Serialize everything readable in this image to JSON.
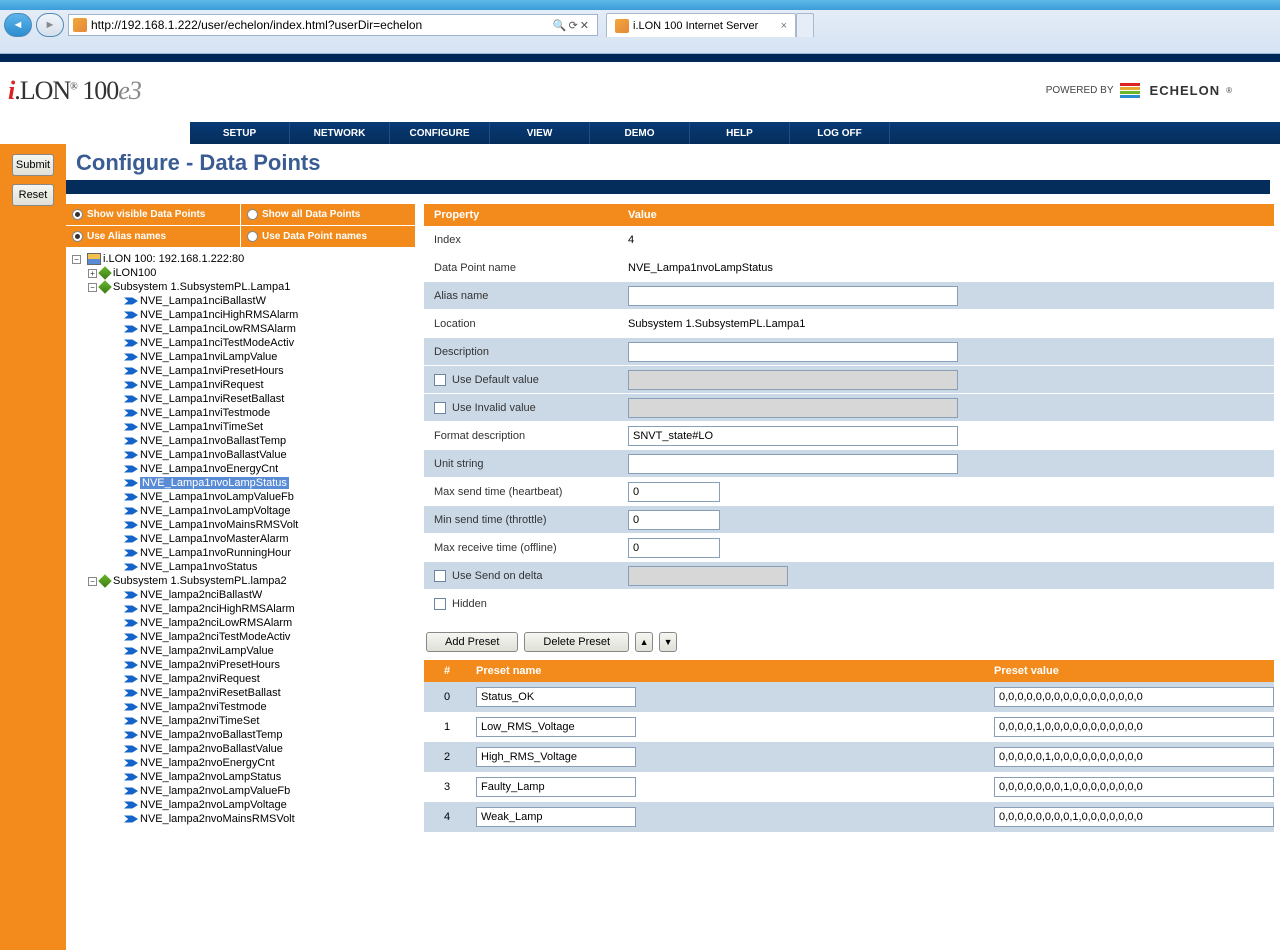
{
  "browser": {
    "url": "http://192.168.1.222/user/echelon/index.html?userDir=echelon",
    "tab_title": "i.LON 100 Internet Server",
    "search_symbol": "🔍",
    "refresh_symbol": "⟳",
    "stop_symbol": "✕"
  },
  "brand": {
    "logo_html": "i.LON 100e3",
    "powered_by": "POWERED BY",
    "vendor": "ECHELON"
  },
  "menu": [
    "SETUP",
    "NETWORK",
    "CONFIGURE",
    "VIEW",
    "DEMO",
    "HELP",
    "LOG OFF"
  ],
  "left_buttons": {
    "submit": "Submit",
    "reset": "Reset"
  },
  "page_title": "Configure - Data Points",
  "toggles": {
    "show_visible": "Show visible Data Points",
    "show_all": "Show all Data Points",
    "use_alias": "Use Alias names",
    "use_dp": "Use Data Point names"
  },
  "tree": {
    "root": "i.LON 100: 192.168.1.222:80",
    "device": "iLON100",
    "subsys1": "Subsystem 1.SubsystemPL.Lampa1",
    "subsys1_items": [
      "NVE_Lampa1nciBallastW",
      "NVE_Lampa1nciHighRMSAlarm",
      "NVE_Lampa1nciLowRMSAlarm",
      "NVE_Lampa1nciTestModeActiv",
      "NVE_Lampa1nviLampValue",
      "NVE_Lampa1nviPresetHours",
      "NVE_Lampa1nviRequest",
      "NVE_Lampa1nviResetBallast",
      "NVE_Lampa1nviTestmode",
      "NVE_Lampa1nviTimeSet",
      "NVE_Lampa1nvoBallastTemp",
      "NVE_Lampa1nvoBallastValue",
      "NVE_Lampa1nvoEnergyCnt",
      "NVE_Lampa1nvoLampStatus",
      "NVE_Lampa1nvoLampValueFb",
      "NVE_Lampa1nvoLampVoltage",
      "NVE_Lampa1nvoMainsRMSVolt",
      "NVE_Lampa1nvoMasterAlarm",
      "NVE_Lampa1nvoRunningHour",
      "NVE_Lampa1nvoStatus"
    ],
    "subsys1_selected_index": 13,
    "subsys2": "Subsystem 1.SubsystemPL.lampa2",
    "subsys2_items": [
      "NVE_lampa2nciBallastW",
      "NVE_lampa2nciHighRMSAlarm",
      "NVE_lampa2nciLowRMSAlarm",
      "NVE_lampa2nciTestModeActiv",
      "NVE_lampa2nviLampValue",
      "NVE_lampa2nviPresetHours",
      "NVE_lampa2nviRequest",
      "NVE_lampa2nviResetBallast",
      "NVE_lampa2nviTestmode",
      "NVE_lampa2nviTimeSet",
      "NVE_lampa2nvoBallastTemp",
      "NVE_lampa2nvoBallastValue",
      "NVE_lampa2nvoEnergyCnt",
      "NVE_lampa2nvoLampStatus",
      "NVE_lampa2nvoLampValueFb",
      "NVE_lampa2nvoLampVoltage",
      "NVE_lampa2nvoMainsRMSVolt"
    ]
  },
  "props_header": {
    "property": "Property",
    "value": "Value"
  },
  "props": {
    "index_label": "Index",
    "index_value": "4",
    "dp_name_label": "Data Point name",
    "dp_name_value": "NVE_Lampa1nvoLampStatus",
    "alias_label": "Alias name",
    "alias_value": "",
    "location_label": "Location",
    "location_value": "Subsystem 1.SubsystemPL.Lampa1",
    "description_label": "Description",
    "description_value": "",
    "use_default_label": "Use Default value",
    "use_default_value": "",
    "use_invalid_label": "Use Invalid value",
    "use_invalid_value": "",
    "format_label": "Format description",
    "format_value": "SNVT_state#LO",
    "unit_label": "Unit string",
    "unit_value": "",
    "max_send_label": "Max send time (heartbeat)",
    "max_send_value": "0",
    "min_send_label": "Min send time (throttle)",
    "min_send_value": "0",
    "max_recv_label": "Max receive time (offline)",
    "max_recv_value": "0",
    "send_delta_label": "Use Send on delta",
    "send_delta_value": "",
    "hidden_label": "Hidden"
  },
  "preset_toolbar": {
    "add": "Add Preset",
    "delete": "Delete Preset"
  },
  "preset_header": {
    "num": "#",
    "name": "Preset name",
    "value": "Preset value"
  },
  "presets": [
    {
      "idx": "0",
      "name": "Status_OK",
      "value": "0,0,0,0,0,0,0,0,0,0,0,0,0,0,0,0"
    },
    {
      "idx": "1",
      "name": "Low_RMS_Voltage",
      "value": "0,0,0,0,1,0,0,0,0,0,0,0,0,0,0,0"
    },
    {
      "idx": "2",
      "name": "High_RMS_Voltage",
      "value": "0,0,0,0,0,1,0,0,0,0,0,0,0,0,0,0"
    },
    {
      "idx": "3",
      "name": "Faulty_Lamp",
      "value": "0,0,0,0,0,0,0,1,0,0,0,0,0,0,0,0"
    },
    {
      "idx": "4",
      "name": "Weak_Lamp",
      "value": "0,0,0,0,0,0,0,0,1,0,0,0,0,0,0,0"
    }
  ]
}
